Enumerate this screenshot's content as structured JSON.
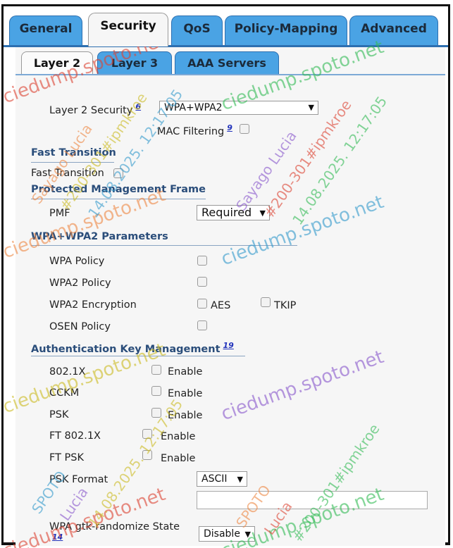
{
  "tabs": [
    "General",
    "Security",
    "QoS",
    "Policy-Mapping",
    "Advanced"
  ],
  "sub_tabs": [
    "Layer 2",
    "Layer 3",
    "AAA Servers"
  ],
  "layer2_security": {
    "label": "Layer 2 Security",
    "help": "6",
    "value": "WPA+WPA2"
  },
  "mac_filtering": {
    "label": "MAC Filtering",
    "help": "9"
  },
  "fast_transition": {
    "heading": "Fast Transition",
    "label": "Fast Transition"
  },
  "pmf": {
    "heading": "Protected Management Frame",
    "label": "PMF",
    "value": "Required"
  },
  "wpa_params": {
    "heading": "WPA+WPA2 Parameters",
    "wpa_policy": "WPA Policy",
    "wpa2_policy": "WPA2 Policy",
    "wpa2_encryption": "WPA2 Encryption",
    "aes": "AES",
    "tkip": "TKIP",
    "osen_policy": "OSEN Policy"
  },
  "akm": {
    "heading": "Authentication Key Management",
    "help": "19",
    "rows": [
      {
        "label": "802.1X",
        "option": "Enable"
      },
      {
        "label": "CCKM",
        "option": "Enable"
      },
      {
        "label": "PSK",
        "option": "Enable"
      },
      {
        "label": "FT 802.1X",
        "option": "Enable"
      },
      {
        "label": "FT PSK",
        "option": "Enable"
      }
    ],
    "psk_format": {
      "label": "PSK Format",
      "value": "ASCII"
    },
    "gtk": {
      "label": "WPA gtk-randomize State",
      "help": "14",
      "value": "Disable"
    }
  },
  "watermark": {
    "lines": [
      "ciedump.spoto.net",
      "Sayago Lucia",
      "#200-301#ipmkroe",
      "14.08.2025. 12:17:05",
      "SPOTO",
      "Lucia"
    ],
    "colors": [
      "#d43",
      "#e84",
      "#cb2",
      "#3b5",
      "#39c",
      "#85c"
    ]
  }
}
